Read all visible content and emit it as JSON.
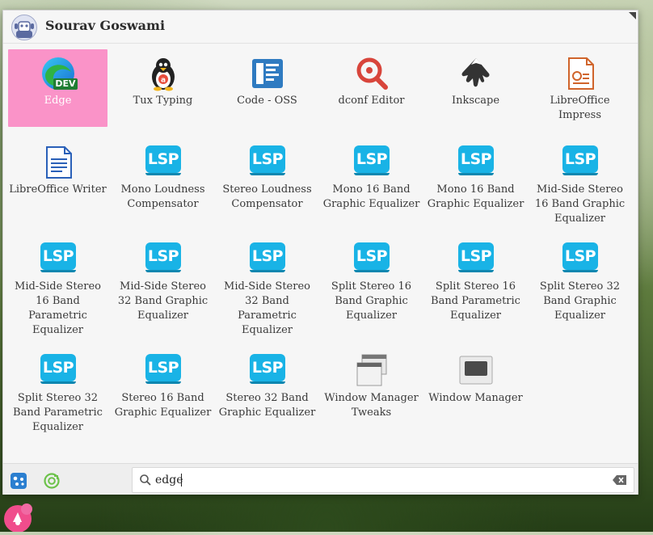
{
  "header": {
    "username": "Sourav Goswami"
  },
  "apps": [
    {
      "label": "Edge",
      "icon": "edge-dev-icon",
      "selected": true
    },
    {
      "label": "Tux Typing",
      "icon": "tux-typing-icon"
    },
    {
      "label": "Code - OSS",
      "icon": "code-oss-icon"
    },
    {
      "label": "dconf Editor",
      "icon": "dconf-editor-icon"
    },
    {
      "label": "Inkscape",
      "icon": "inkscape-icon"
    },
    {
      "label": "LibreOffice Impress",
      "icon": "libreoffice-impress-icon"
    },
    {
      "label": "LibreOffice Writer",
      "icon": "libreoffice-writer-icon"
    },
    {
      "label": "Mono Loudness Compensator",
      "icon": "lsp-icon"
    },
    {
      "label": "Stereo Loudness Compensator",
      "icon": "lsp-icon"
    },
    {
      "label": "Mono 16 Band Graphic Equalizer",
      "icon": "lsp-icon"
    },
    {
      "label": "Mono 16 Band Graphic Equalizer",
      "icon": "lsp-icon"
    },
    {
      "label": "Mid-Side Stereo 16 Band Graphic Equalizer",
      "icon": "lsp-icon"
    },
    {
      "label": "Mid-Side Stereo 16 Band Parametric Equalizer",
      "icon": "lsp-icon"
    },
    {
      "label": "Mid-Side Stereo 32 Band Graphic Equalizer",
      "icon": "lsp-icon"
    },
    {
      "label": "Mid-Side Stereo 32 Band Parametric Equalizer",
      "icon": "lsp-icon"
    },
    {
      "label": "Split Stereo 16 Band Graphic Equalizer",
      "icon": "lsp-icon"
    },
    {
      "label": "Split Stereo 16 Band Parametric Equalizer",
      "icon": "lsp-icon"
    },
    {
      "label": "Split Stereo 32 Band Graphic Equalizer",
      "icon": "lsp-icon"
    },
    {
      "label": "Split Stereo 32 Band Parametric Equalizer",
      "icon": "lsp-icon"
    },
    {
      "label": "Stereo 16 Band Graphic Equalizer",
      "icon": "lsp-icon"
    },
    {
      "label": "Stereo 32 Band Graphic Equalizer",
      "icon": "lsp-icon"
    },
    {
      "label": "Window Manager Tweaks",
      "icon": "window-manager-tweaks-icon"
    },
    {
      "label": "Window Manager",
      "icon": "window-manager-icon"
    }
  ],
  "lsp_text": "LSP",
  "edge_badge": "DEV",
  "search": {
    "value": "edge"
  },
  "colors": {
    "selected": "#fa93c8",
    "lsp": "#19b3e6",
    "accent": "#3875d7"
  }
}
